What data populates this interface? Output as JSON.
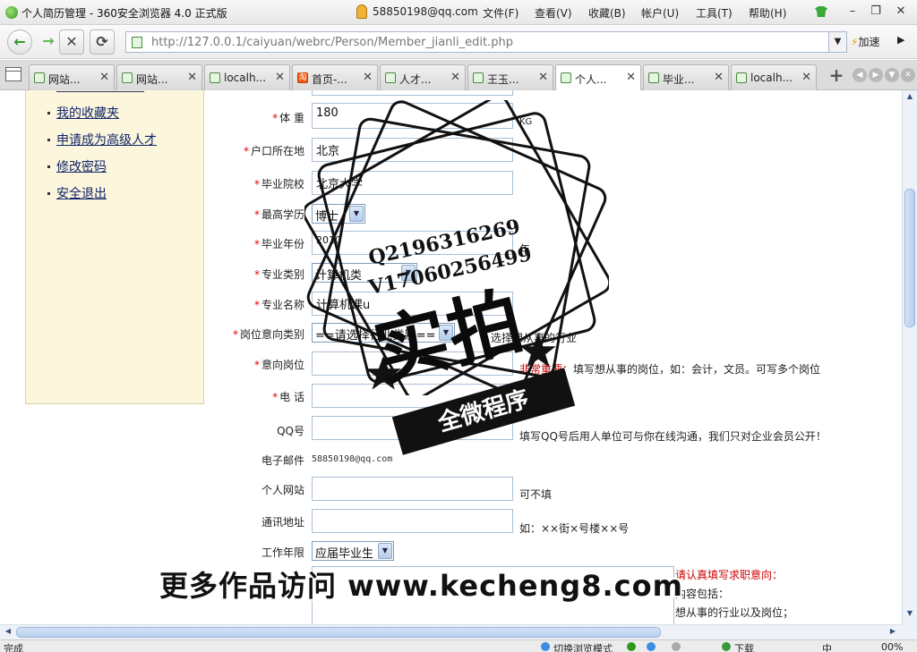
{
  "window": {
    "title": "个人简历管理 - 360安全浏览器 4.0 正式版",
    "account": "58850198@qq.com",
    "menus": [
      "文件(F)",
      "查看(V)",
      "收藏(B)",
      "帐户(U)",
      "工具(T)",
      "帮助(H)"
    ],
    "controls": {
      "minimize": "–",
      "restore": "❐",
      "close": "✕"
    }
  },
  "toolbar": {
    "back": "←",
    "forward": "→",
    "stop": "✕",
    "reload": "⟳",
    "url": "http://127.0.0.1/caiyuan/webrc/Person/Member_jianli_edit.php",
    "dropdown": "▼",
    "speedup_label": "加速",
    "speedup_icon": "⚡",
    "more": "▶"
  },
  "tabs": [
    {
      "label": "网站...",
      "active": false,
      "icon": "page-icon"
    },
    {
      "label": "网站...",
      "active": false,
      "icon": "page-icon"
    },
    {
      "label": "localh...",
      "active": false,
      "icon": "page-icon"
    },
    {
      "label": "首页-...",
      "active": false,
      "icon": "taobao-icon",
      "icon_text": "淘"
    },
    {
      "label": "人才...",
      "active": false,
      "icon": "page-icon"
    },
    {
      "label": "王玉...",
      "active": false,
      "icon": "page-icon"
    },
    {
      "label": "个人...",
      "active": true,
      "icon": "page-icon"
    },
    {
      "label": "毕业...",
      "active": false,
      "icon": "page-icon"
    },
    {
      "label": "localh...",
      "active": false,
      "icon": "page-icon"
    }
  ],
  "tab_close": "✕",
  "new_tab": "+",
  "sidebar": {
    "links": [
      "我的收藏夹",
      "申请成为高级人才",
      "修改密码",
      "安全退出"
    ]
  },
  "form": {
    "required_mark": "*",
    "weight": {
      "label": "体 重",
      "value": "180",
      "unit": "KG"
    },
    "hukou": {
      "label": "户口所在地",
      "value": "北京"
    },
    "school": {
      "label": "毕业院校",
      "value": "北京大学"
    },
    "degree": {
      "label": "最高学历",
      "value": "博士"
    },
    "grad_year": {
      "label": "毕业年份",
      "value": "2010",
      "unit": "年"
    },
    "major_category": {
      "label": "专业类别",
      "value": "计算机类"
    },
    "major_name": {
      "label": "专业名称",
      "value": "计算机课u"
    },
    "job_category": {
      "label": "岗位意向类别",
      "value": "==请选择行业类别==",
      "hint": "选择想从事的行业"
    },
    "job_intent": {
      "label": "意向岗位",
      "hint_warn": "非常重要：",
      "hint": "填写想从事的岗位，如：会计，文员。可写多个岗位"
    },
    "phone": {
      "label": "电 话"
    },
    "qq": {
      "label": "QQ号",
      "hint": "填写QQ号后用人单位可与你在线沟通，我们只对企业会员公开！"
    },
    "email": {
      "label": "电子邮件",
      "value": "58850198@qq.com"
    },
    "website": {
      "label": "个人网站",
      "hint": "可不填"
    },
    "address": {
      "label": "通讯地址",
      "hint": "如：××街×号楼××号"
    },
    "experience": {
      "label": "工作年限",
      "value": "应届毕业生"
    },
    "objective": {
      "head": "请认真填写求职意向：",
      "line1": "内容包括：",
      "line2": "想从事的行业以及岗位；"
    }
  },
  "watermark": {
    "contact_q": "Q2196316269",
    "contact_v": "V17060256499",
    "big_text": "实拍",
    "ribbon_text": "全微程序",
    "banner": "更多作品访问 www.kecheng8.com"
  },
  "statusbar": {
    "left": "完成",
    "mode": "切换浏览模式",
    "download": "下载",
    "ime": "中",
    "zoom": "00%"
  }
}
